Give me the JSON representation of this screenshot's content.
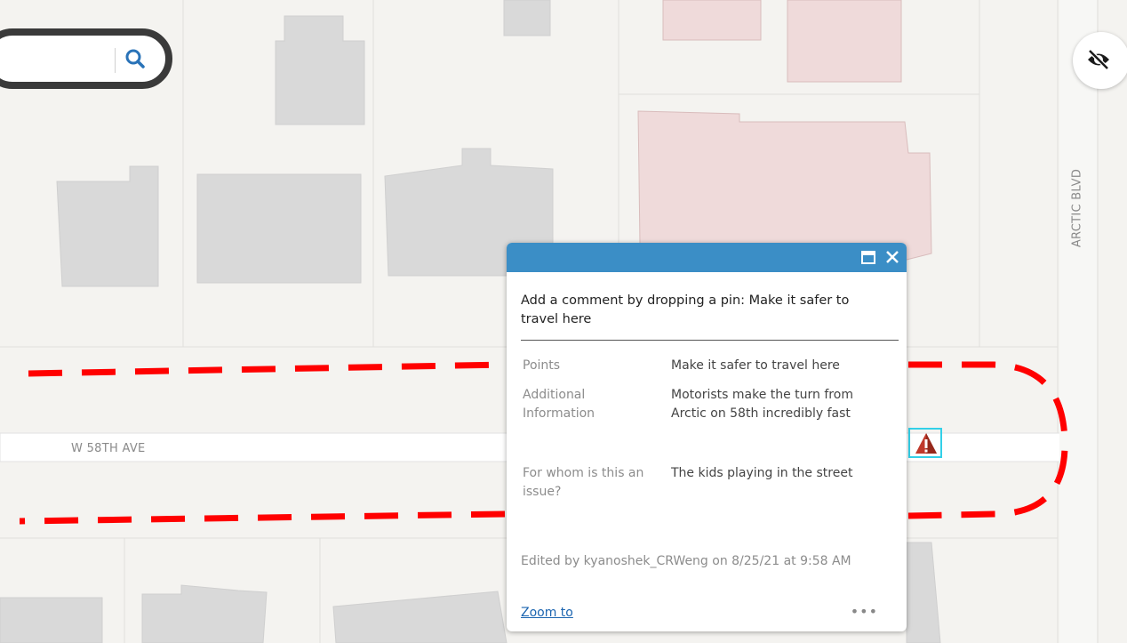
{
  "map": {
    "streets": {
      "w58th": "W 58TH AVE",
      "arctic": "ARCTIC BLVD"
    },
    "route_color": "#ff0000",
    "building_color": "#d9d9d9",
    "commercial_color": "#efdada",
    "background_color": "#f4f3f0"
  },
  "search": {
    "value": "",
    "placeholder": "",
    "icon": "search-icon"
  },
  "toggle": {
    "icon": "eye-off-icon"
  },
  "pin": {
    "icon": "warning-pin-icon",
    "color": "#c0392b",
    "highlight_color": "#33d0e8"
  },
  "popup": {
    "header_color": "#3b8ec6",
    "title": "Add a comment by dropping a pin: Make it safer to travel here",
    "attributes": [
      {
        "label": "Points",
        "value": "Make it safer to travel here"
      },
      {
        "label": "Additional Information",
        "value": "Motorists make the turn from Arctic on 58th incredibly fast"
      },
      {
        "label": "For whom is this an issue?",
        "value": "The kids playing in the street"
      }
    ],
    "edited": "Edited by kyanoshek_CRWeng on 8/25/21 at 9:58 AM",
    "zoom_to": "Zoom to",
    "more": "•••"
  }
}
